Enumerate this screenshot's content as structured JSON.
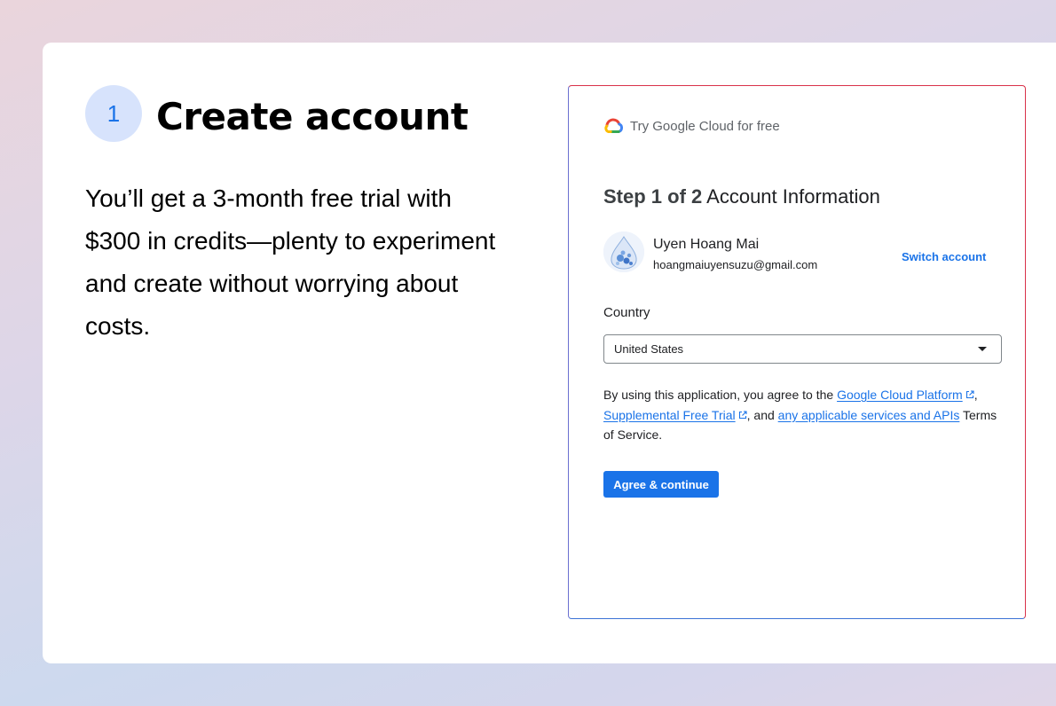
{
  "step_badge": {
    "number": "1"
  },
  "headline": "Create account",
  "description": "You’ll get a 3-month free trial with $300 in credits—plenty to experiment and create without worrying about costs.",
  "panel": {
    "brand": {
      "icon": "google-cloud-logo-icon",
      "text": "Try Google Cloud for free"
    },
    "step_label": "Step 1 of 2",
    "step_title": "Account Information",
    "user": {
      "avatar_icon": "avatar-illustration",
      "name": "Uyen Hoang Mai",
      "email": "hoangmaiuyensuzu@gmail.com"
    },
    "switch_account_label": "Switch account",
    "country": {
      "label": "Country",
      "value": "United States",
      "icon": "caret-down-icon"
    },
    "terms": {
      "prefix": "By using this application, you agree to the ",
      "link1": "Google Cloud Platform",
      "comma": ",",
      "link2": "Supplemental Free Trial",
      "middle": ", and ",
      "link3": "any applicable services and APIs",
      "suffix": "Terms of Service.",
      "external_icon": "external-link-icon"
    },
    "agree_button_label": "Agree & continue"
  },
  "colors": {
    "accent": "#1a73e8",
    "badge_bg": "#d7e3fc",
    "text": "#202124",
    "muted": "#5f6368"
  }
}
